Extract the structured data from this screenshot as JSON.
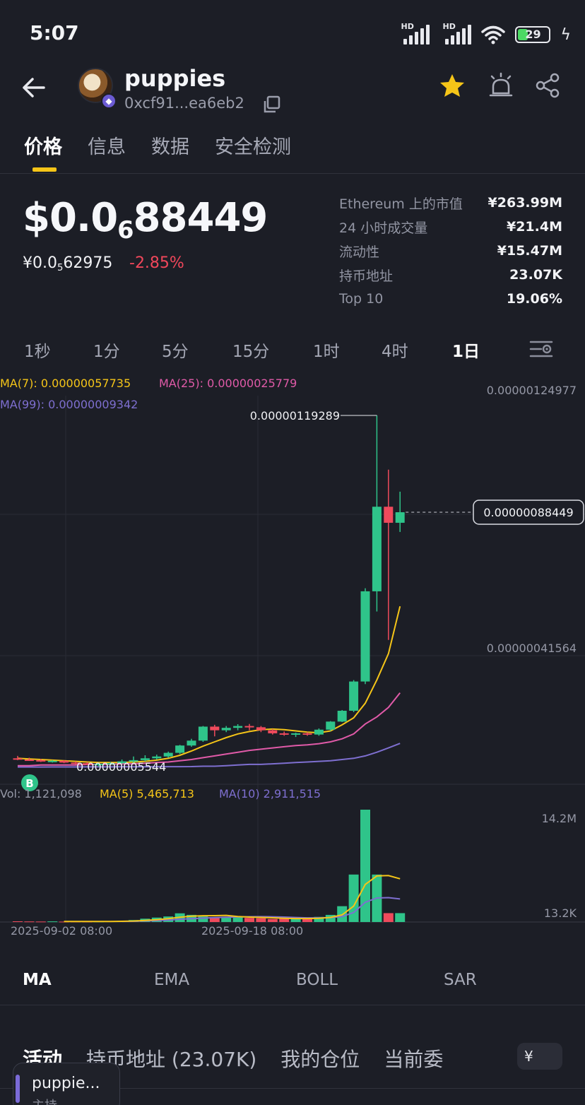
{
  "status_bar": {
    "time": "5:07",
    "net1": "HD",
    "net2": "HD",
    "battery": "29"
  },
  "header": {
    "name": "puppies",
    "address": "0xcf91...ea6eb2"
  },
  "tabs": [
    "价格",
    "信息",
    "数据",
    "安全检测"
  ],
  "price": {
    "big_prefix": "$0.0",
    "big_sub": "6",
    "big_rest": "88449",
    "cny_prefix": "¥0.0",
    "cny_sub": "5",
    "cny_rest": "62975",
    "change": "-2.85%"
  },
  "stats": [
    {
      "label": "Ethereum 上的市值",
      "value": "¥263.99M"
    },
    {
      "label": "24 小时成交量",
      "value": "¥21.4M"
    },
    {
      "label": "流动性",
      "value": "¥15.47M"
    },
    {
      "label": "持币地址",
      "value": "23.07K"
    },
    {
      "label": "Top 10",
      "value": "19.06%"
    }
  ],
  "intervals": {
    "items": [
      "1秒",
      "1分",
      "5分",
      "15分",
      "1时",
      "4时",
      "1日"
    ],
    "active": "1日"
  },
  "chart_data": {
    "type": "candlestick",
    "interval": "1日",
    "legend": {
      "ma7": "MA(7): 0.00000057735",
      "ma25": "MA(25): 0.00000025779",
      "ma99": "MA(99): 0.00000009342"
    },
    "price_ticks": [
      "0.00000124977",
      "0.00000041564"
    ],
    "current_price_label": "0.00000088449",
    "current_price": 8.8449e-07,
    "high_label": "0.00000119289",
    "high": 1.19289e-06,
    "low_label": "0.00000005544",
    "low": 5.544e-08,
    "buy_marker": "B",
    "candles": [
      {
        "o": 6.9e-08,
        "h": 7.3e-08,
        "l": 6.6e-08,
        "c": 6.7e-08
      },
      {
        "o": 6.7e-08,
        "h": 7e-08,
        "l": 6.5e-08,
        "c": 6.6e-08
      },
      {
        "o": 6.6e-08,
        "h": 6.8e-08,
        "l": 6.3e-08,
        "c": 6.4e-08
      },
      {
        "o": 6.4e-08,
        "h": 6.6e-08,
        "l": 6.2e-08,
        "c": 6.5e-08
      },
      {
        "o": 6.5e-08,
        "h": 6.6e-08,
        "l": 6.1e-08,
        "c": 6.2e-08
      },
      {
        "o": 6.2e-08,
        "h": 6.4e-08,
        "l": 5.9e-08,
        "c": 6.1e-08
      },
      {
        "o": 6.1e-08,
        "h": 6.3e-08,
        "l": 5.8e-08,
        "c": 6e-08
      },
      {
        "o": 6e-08,
        "h": 6.2e-08,
        "l": 5.544e-08,
        "c": 6e-08
      },
      {
        "o": 6e-08,
        "h": 6.3e-08,
        "l": 5.8e-08,
        "c": 6.1e-08
      },
      {
        "o": 6.1e-08,
        "h": 6.7e-08,
        "l": 6e-08,
        "c": 6.4e-08
      },
      {
        "o": 6.4e-08,
        "h": 7.2e-08,
        "l": 6.2e-08,
        "c": 6.6e-08
      },
      {
        "o": 6.6e-08,
        "h": 7.4e-08,
        "l": 6.4e-08,
        "c": 6.9e-08
      },
      {
        "o": 6.9e-08,
        "h": 7.5e-08,
        "l": 6.7e-08,
        "c": 7.2e-08
      },
      {
        "o": 7.2e-08,
        "h": 8e-08,
        "l": 7e-08,
        "c": 7.8e-08
      },
      {
        "o": 7.8e-08,
        "h": 9.1e-08,
        "l": 7.6e-08,
        "c": 9e-08
      },
      {
        "o": 9e-08,
        "h": 1.01e-07,
        "l": 8.8e-08,
        "c": 9.8e-08
      },
      {
        "o": 9.8e-08,
        "h": 1.22e-07,
        "l": 9.6e-08,
        "c": 1.21e-07
      },
      {
        "o": 1.21e-07,
        "h": 1.24e-07,
        "l": 1.05e-07,
        "c": 1.15e-07
      },
      {
        "o": 1.15e-07,
        "h": 1.22e-07,
        "l": 1.12e-07,
        "c": 1.19e-07
      },
      {
        "o": 1.19e-07,
        "h": 1.25e-07,
        "l": 1.15e-07,
        "c": 1.22e-07
      },
      {
        "o": 1.22e-07,
        "h": 1.26e-07,
        "l": 1.15e-07,
        "c": 1.2e-07
      },
      {
        "o": 1.2e-07,
        "h": 1.22e-07,
        "l": 1.12e-07,
        "c": 1.15e-07
      },
      {
        "o": 1.15e-07,
        "h": 1.17e-07,
        "l": 1.08e-07,
        "c": 1.1e-07
      },
      {
        "o": 1.1e-07,
        "h": 1.13e-07,
        "l": 1.06e-07,
        "c": 1.08e-07
      },
      {
        "o": 1.08e-07,
        "h": 1.11e-07,
        "l": 1.04e-07,
        "c": 1.1e-07
      },
      {
        "o": 1.1e-07,
        "h": 1.12e-07,
        "l": 1.06e-07,
        "c": 1.08e-07
      },
      {
        "o": 1.08e-07,
        "h": 1.18e-07,
        "l": 1.06e-07,
        "c": 1.16e-07
      },
      {
        "o": 1.16e-07,
        "h": 1.38e-07,
        "l": 1.14e-07,
        "c": 1.36e-07
      },
      {
        "o": 1.36e-07,
        "h": 1.85e-07,
        "l": 1.34e-07,
        "c": 1.82e-07
      },
      {
        "o": 1.82e-07,
        "h": 3.12e-07,
        "l": 1.76e-07,
        "c": 3.06e-07
      },
      {
        "o": 3.06e-07,
        "h": 6.36e-07,
        "l": 2.95e-07,
        "c": 6.26e-07
      },
      {
        "o": 6.26e-07,
        "h": 1.19289e-06,
        "l": 5.6e-07,
        "c": 9.02e-07
      },
      {
        "o": 9.02e-07,
        "h": 1.02e-06,
        "l": 4.67e-07,
        "c": 8.5e-07
      },
      {
        "o": 8.5e-07,
        "h": 9.5e-07,
        "l": 8.2e-07,
        "c": 8.8449e-07
      }
    ],
    "ma_lines": {
      "ma7": [
        6.9e-08,
        6.8e-08,
        6.7e-08,
        6.6e-08,
        6.5e-08,
        6.4e-08,
        6.3e-08,
        6.2e-08,
        6.2e-08,
        6.2e-08,
        6.3e-08,
        6.4e-08,
        6.6e-08,
        6.9e-08,
        7.4e-08,
        8.1e-08,
        8.9e-08,
        9.6e-08,
        1.03e-07,
        1.09e-07,
        1.13e-07,
        1.16e-07,
        1.17e-07,
        1.16e-07,
        1.14e-07,
        1.12e-07,
        1.11e-07,
        1.14e-07,
        1.24e-07,
        1.52e-07,
        2.14e-07,
        3.13e-07,
        4.22e-07,
        5.77e-07
      ],
      "ma25": [
        5.7e-08,
        5.7e-08,
        5.8e-08,
        5.8e-08,
        5.8e-08,
        5.8e-08,
        5.9e-08,
        5.9e-08,
        5.9e-08,
        6e-08,
        6e-08,
        6.1e-08,
        6.2e-08,
        6.3e-08,
        6.5e-08,
        6.7e-08,
        7e-08,
        7.3e-08,
        7.6e-08,
        7.9e-08,
        8.2e-08,
        8.4e-08,
        8.6e-08,
        8.8e-08,
        9e-08,
        9.1e-08,
        9.3e-08,
        9.6e-08,
        1.01e-07,
        1.09e-07,
        1.26e-07,
        1.56e-07,
        1.96e-07,
        2.58e-07
      ],
      "ma99": [
        4.9e-08,
        4.9e-08,
        4.9e-08,
        5e-08,
        5e-08,
        5e-08,
        5.1e-08,
        5.1e-08,
        5.1e-08,
        5.2e-08,
        5.2e-08,
        5.3e-08,
        5.3e-08,
        5.4e-08,
        5.4e-08,
        5.5e-08,
        5.6e-08,
        5.6e-08,
        5.7e-08,
        5.8e-08,
        5.9e-08,
        5.9e-08,
        6e-08,
        6.1e-08,
        6.2e-08,
        6.3e-08,
        6.4e-08,
        6.5e-08,
        6.7e-08,
        6.9e-08,
        7.3e-08,
        7.9e-08,
        8.6e-08,
        9.342e-08
      ]
    },
    "volume": {
      "legend": {
        "vol": "Vol: 1,121,098",
        "ma5": "MA(5) 5,465,713",
        "ma10": "MA(10) 2,911,515"
      },
      "ticks": [
        "14.2M",
        "13.2K"
      ],
      "values": [
        90000,
        70000,
        60000,
        80000,
        50000,
        60000,
        55000,
        70000,
        90000,
        150000,
        250000,
        420000,
        560000,
        700000,
        1100000,
        900000,
        700000,
        620000,
        680000,
        600000,
        520000,
        480000,
        380000,
        400000,
        420000,
        520000,
        650000,
        900000,
        2000000,
        6000000,
        14200000,
        6000000,
        1121098,
        1121098
      ],
      "ma5": [
        null,
        null,
        null,
        null,
        70000,
        64000,
        63000,
        63000,
        65000,
        85000,
        123000,
        196000,
        294000,
        416000,
        606000,
        742000,
        792000,
        804000,
        836000,
        700000,
        624000,
        580000,
        532000,
        476000,
        440000,
        440000,
        474000,
        578000,
        898000,
        2014000,
        4750000,
        5820000,
        5864000,
        5465713
      ],
      "ma10": [
        null,
        null,
        null,
        null,
        null,
        null,
        null,
        null,
        null,
        77500,
        93500,
        129500,
        179500,
        241500,
        346500,
        430500,
        495000,
        550000,
        609000,
        654000,
        669000,
        675000,
        657000,
        627000,
        569000,
        531000,
        526000,
        554000,
        686000,
        1210000,
        2490000,
        3040000,
        3080000,
        2911515
      ]
    },
    "x_ticks": [
      "2025-09-02 08:00",
      "2025-09-18 08:00"
    ]
  },
  "indicators": {
    "items": [
      "MA",
      "EMA",
      "BOLL",
      "SAR"
    ],
    "active": "MA"
  },
  "bottom_tabs": {
    "items": [
      "活动",
      "持币地址 (23.07K)",
      "我的仓位",
      "当前委"
    ],
    "currency": "¥"
  },
  "float_card": {
    "title": "puppie...",
    "subtitle": "主持"
  }
}
